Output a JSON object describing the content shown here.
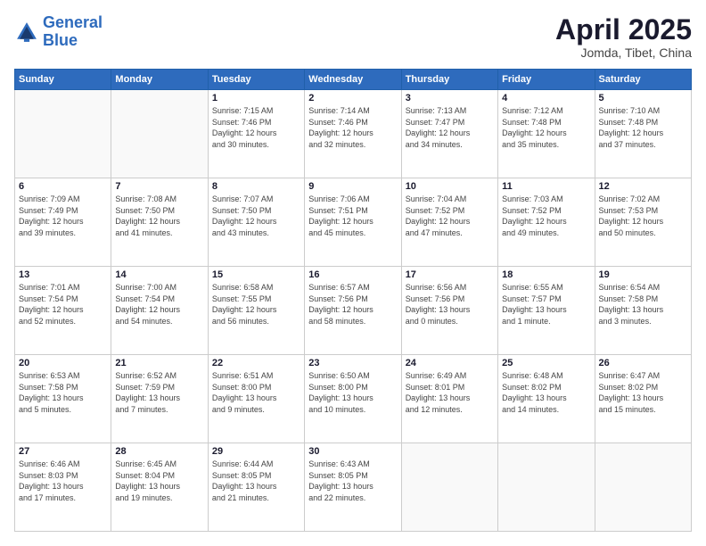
{
  "logo": {
    "line1": "General",
    "line2": "Blue"
  },
  "title": "April 2025",
  "subtitle": "Jomda, Tibet, China",
  "days_header": [
    "Sunday",
    "Monday",
    "Tuesday",
    "Wednesday",
    "Thursday",
    "Friday",
    "Saturday"
  ],
  "weeks": [
    [
      {
        "num": "",
        "info": ""
      },
      {
        "num": "",
        "info": ""
      },
      {
        "num": "1",
        "info": "Sunrise: 7:15 AM\nSunset: 7:46 PM\nDaylight: 12 hours\nand 30 minutes."
      },
      {
        "num": "2",
        "info": "Sunrise: 7:14 AM\nSunset: 7:46 PM\nDaylight: 12 hours\nand 32 minutes."
      },
      {
        "num": "3",
        "info": "Sunrise: 7:13 AM\nSunset: 7:47 PM\nDaylight: 12 hours\nand 34 minutes."
      },
      {
        "num": "4",
        "info": "Sunrise: 7:12 AM\nSunset: 7:48 PM\nDaylight: 12 hours\nand 35 minutes."
      },
      {
        "num": "5",
        "info": "Sunrise: 7:10 AM\nSunset: 7:48 PM\nDaylight: 12 hours\nand 37 minutes."
      }
    ],
    [
      {
        "num": "6",
        "info": "Sunrise: 7:09 AM\nSunset: 7:49 PM\nDaylight: 12 hours\nand 39 minutes."
      },
      {
        "num": "7",
        "info": "Sunrise: 7:08 AM\nSunset: 7:50 PM\nDaylight: 12 hours\nand 41 minutes."
      },
      {
        "num": "8",
        "info": "Sunrise: 7:07 AM\nSunset: 7:50 PM\nDaylight: 12 hours\nand 43 minutes."
      },
      {
        "num": "9",
        "info": "Sunrise: 7:06 AM\nSunset: 7:51 PM\nDaylight: 12 hours\nand 45 minutes."
      },
      {
        "num": "10",
        "info": "Sunrise: 7:04 AM\nSunset: 7:52 PM\nDaylight: 12 hours\nand 47 minutes."
      },
      {
        "num": "11",
        "info": "Sunrise: 7:03 AM\nSunset: 7:52 PM\nDaylight: 12 hours\nand 49 minutes."
      },
      {
        "num": "12",
        "info": "Sunrise: 7:02 AM\nSunset: 7:53 PM\nDaylight: 12 hours\nand 50 minutes."
      }
    ],
    [
      {
        "num": "13",
        "info": "Sunrise: 7:01 AM\nSunset: 7:54 PM\nDaylight: 12 hours\nand 52 minutes."
      },
      {
        "num": "14",
        "info": "Sunrise: 7:00 AM\nSunset: 7:54 PM\nDaylight: 12 hours\nand 54 minutes."
      },
      {
        "num": "15",
        "info": "Sunrise: 6:58 AM\nSunset: 7:55 PM\nDaylight: 12 hours\nand 56 minutes."
      },
      {
        "num": "16",
        "info": "Sunrise: 6:57 AM\nSunset: 7:56 PM\nDaylight: 12 hours\nand 58 minutes."
      },
      {
        "num": "17",
        "info": "Sunrise: 6:56 AM\nSunset: 7:56 PM\nDaylight: 13 hours\nand 0 minutes."
      },
      {
        "num": "18",
        "info": "Sunrise: 6:55 AM\nSunset: 7:57 PM\nDaylight: 13 hours\nand 1 minute."
      },
      {
        "num": "19",
        "info": "Sunrise: 6:54 AM\nSunset: 7:58 PM\nDaylight: 13 hours\nand 3 minutes."
      }
    ],
    [
      {
        "num": "20",
        "info": "Sunrise: 6:53 AM\nSunset: 7:58 PM\nDaylight: 13 hours\nand 5 minutes."
      },
      {
        "num": "21",
        "info": "Sunrise: 6:52 AM\nSunset: 7:59 PM\nDaylight: 13 hours\nand 7 minutes."
      },
      {
        "num": "22",
        "info": "Sunrise: 6:51 AM\nSunset: 8:00 PM\nDaylight: 13 hours\nand 9 minutes."
      },
      {
        "num": "23",
        "info": "Sunrise: 6:50 AM\nSunset: 8:00 PM\nDaylight: 13 hours\nand 10 minutes."
      },
      {
        "num": "24",
        "info": "Sunrise: 6:49 AM\nSunset: 8:01 PM\nDaylight: 13 hours\nand 12 minutes."
      },
      {
        "num": "25",
        "info": "Sunrise: 6:48 AM\nSunset: 8:02 PM\nDaylight: 13 hours\nand 14 minutes."
      },
      {
        "num": "26",
        "info": "Sunrise: 6:47 AM\nSunset: 8:02 PM\nDaylight: 13 hours\nand 15 minutes."
      }
    ],
    [
      {
        "num": "27",
        "info": "Sunrise: 6:46 AM\nSunset: 8:03 PM\nDaylight: 13 hours\nand 17 minutes."
      },
      {
        "num": "28",
        "info": "Sunrise: 6:45 AM\nSunset: 8:04 PM\nDaylight: 13 hours\nand 19 minutes."
      },
      {
        "num": "29",
        "info": "Sunrise: 6:44 AM\nSunset: 8:05 PM\nDaylight: 13 hours\nand 21 minutes."
      },
      {
        "num": "30",
        "info": "Sunrise: 6:43 AM\nSunset: 8:05 PM\nDaylight: 13 hours\nand 22 minutes."
      },
      {
        "num": "",
        "info": ""
      },
      {
        "num": "",
        "info": ""
      },
      {
        "num": "",
        "info": ""
      }
    ]
  ]
}
